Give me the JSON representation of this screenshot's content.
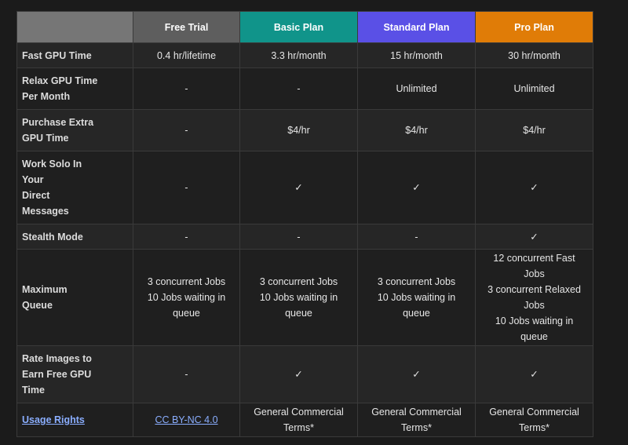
{
  "header": {
    "corner": "",
    "plans": [
      "Free Trial",
      "Basic Plan",
      "Standard Plan",
      "Pro Plan"
    ]
  },
  "rows": [
    {
      "feature": "Fast GPU Time",
      "values": [
        "0.4 hr/lifetime",
        "3.3 hr/month",
        "15 hr/month",
        "30 hr/month"
      ]
    },
    {
      "feature": "Relax GPU Time\nPer Month",
      "values": [
        "-",
        "-",
        "Unlimited",
        "Unlimited"
      ]
    },
    {
      "feature": "Purchase Extra\nGPU Time",
      "values": [
        "-",
        "$4/hr",
        "$4/hr",
        "$4/hr"
      ]
    },
    {
      "feature": "Work Solo In\nYour\nDirect\nMessages",
      "values": [
        "-",
        "✓",
        "✓",
        "✓"
      ]
    },
    {
      "feature": "Stealth Mode",
      "values": [
        "-",
        "-",
        "-",
        "✓"
      ]
    },
    {
      "feature": "Maximum\nQueue",
      "values": [
        "3 concurrent Jobs\n10 Jobs waiting in\nqueue",
        "3 concurrent Jobs\n10 Jobs waiting in\nqueue",
        "3 concurrent Jobs\n10 Jobs waiting in\nqueue",
        "12 concurrent Fast\nJobs\n3 concurrent Relaxed\nJobs\n10 Jobs waiting in\nqueue"
      ]
    },
    {
      "feature": "Rate Images to\nEarn Free GPU\nTime",
      "values": [
        "-",
        "✓",
        "✓",
        "✓"
      ]
    },
    {
      "feature": "Usage Rights",
      "values": [
        "CC BY-NC 4.0",
        "General Commercial\nTerms*",
        "General Commercial\nTerms*",
        "General Commercial\nTerms*"
      ]
    }
  ],
  "colors": {
    "corner": "#767676",
    "free": "#5e5e5e",
    "basic": "#10948a",
    "standard": "#5a50e6",
    "pro": "#e07c07",
    "link": "#8aaeff"
  }
}
